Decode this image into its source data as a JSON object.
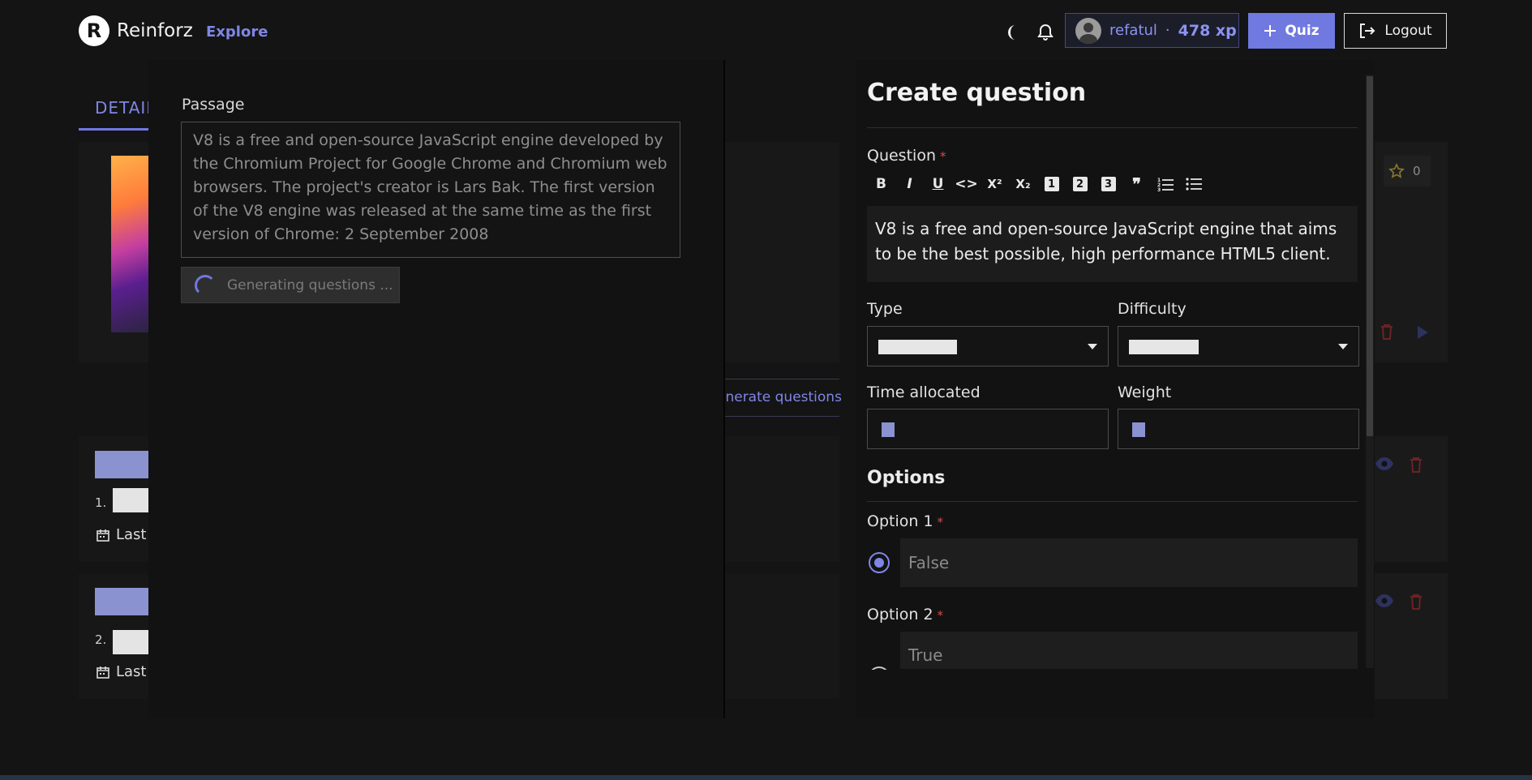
{
  "header": {
    "logo_letter": "R",
    "brand": "Reinforz",
    "explore": "Explore",
    "username": "refatul",
    "separator": "·",
    "xp": "478 xp",
    "quiz_button": "Quiz",
    "logout_button": "Logout",
    "theme_icon": "moon-icon",
    "notification_icon": "bell-icon"
  },
  "background": {
    "tab_details": "DETAIL",
    "generate_questions_tab": "enerate questions",
    "star_count": "0",
    "rows": [
      {
        "number": "1.",
        "last_label": "Last u"
      },
      {
        "number": "2.",
        "last_label": "Last u"
      }
    ]
  },
  "passage_modal": {
    "label": "Passage",
    "text": "V8 is a free and open-source JavaScript engine developed by the Chromium Project for Google Chrome and Chromium web browsers. The project's creator is Lars Bak. The first version of the V8 engine was released at the same time as the first version of Chrome: 2 September 2008",
    "generating_button": "Generating questions ..."
  },
  "create_question": {
    "title": "Create question",
    "question_label": "Question",
    "required_mark": "*",
    "toolbar": [
      "B",
      "I",
      "U",
      "<>",
      "X²",
      "X₂",
      "1",
      "2",
      "3",
      "99",
      "ordered-list",
      "bullet-list"
    ],
    "question_text": "V8 is a free and open-source JavaScript engine that aims to be the best possible, high performance HTML5 client.",
    "type_label": "Type",
    "difficulty_label": "Difficulty",
    "time_label": "Time allocated",
    "weight_label": "Weight",
    "options_title": "Options",
    "options": [
      {
        "label": "Option 1",
        "value": "False",
        "selected": true
      },
      {
        "label": "Option 2",
        "value": "True",
        "selected": false
      }
    ]
  },
  "colors": {
    "accent": "#6f79e0",
    "background": "#141414",
    "panel": "#121212",
    "danger": "#d94b4b"
  }
}
